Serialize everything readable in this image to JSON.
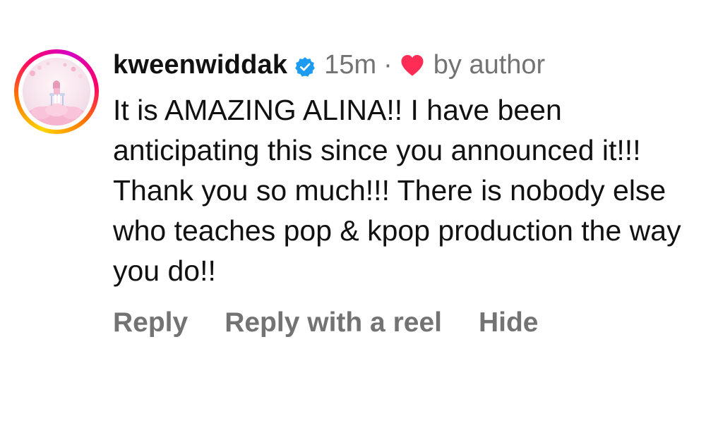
{
  "comment": {
    "username": "kweenwiddak",
    "verified": true,
    "time_ago": "15m",
    "separator": "·",
    "liked_by_author_label": "by author",
    "text": "It is AMAZING ALINA!! I have been anticipating this since you announced it!!! Thank you so much!!! There is nobody else who teaches pop & kpop production the way you do!!",
    "actions": {
      "reply": "Reply",
      "reply_with_reel": "Reply with a reel",
      "hide": "Hide"
    }
  },
  "colors": {
    "verified_badge": "#1d9bf0",
    "heart": "#ff2d55",
    "meta_text": "#737373",
    "primary_text": "#111111"
  },
  "icons": {
    "verified": "verified-badge-icon",
    "heart": "heart-icon"
  }
}
